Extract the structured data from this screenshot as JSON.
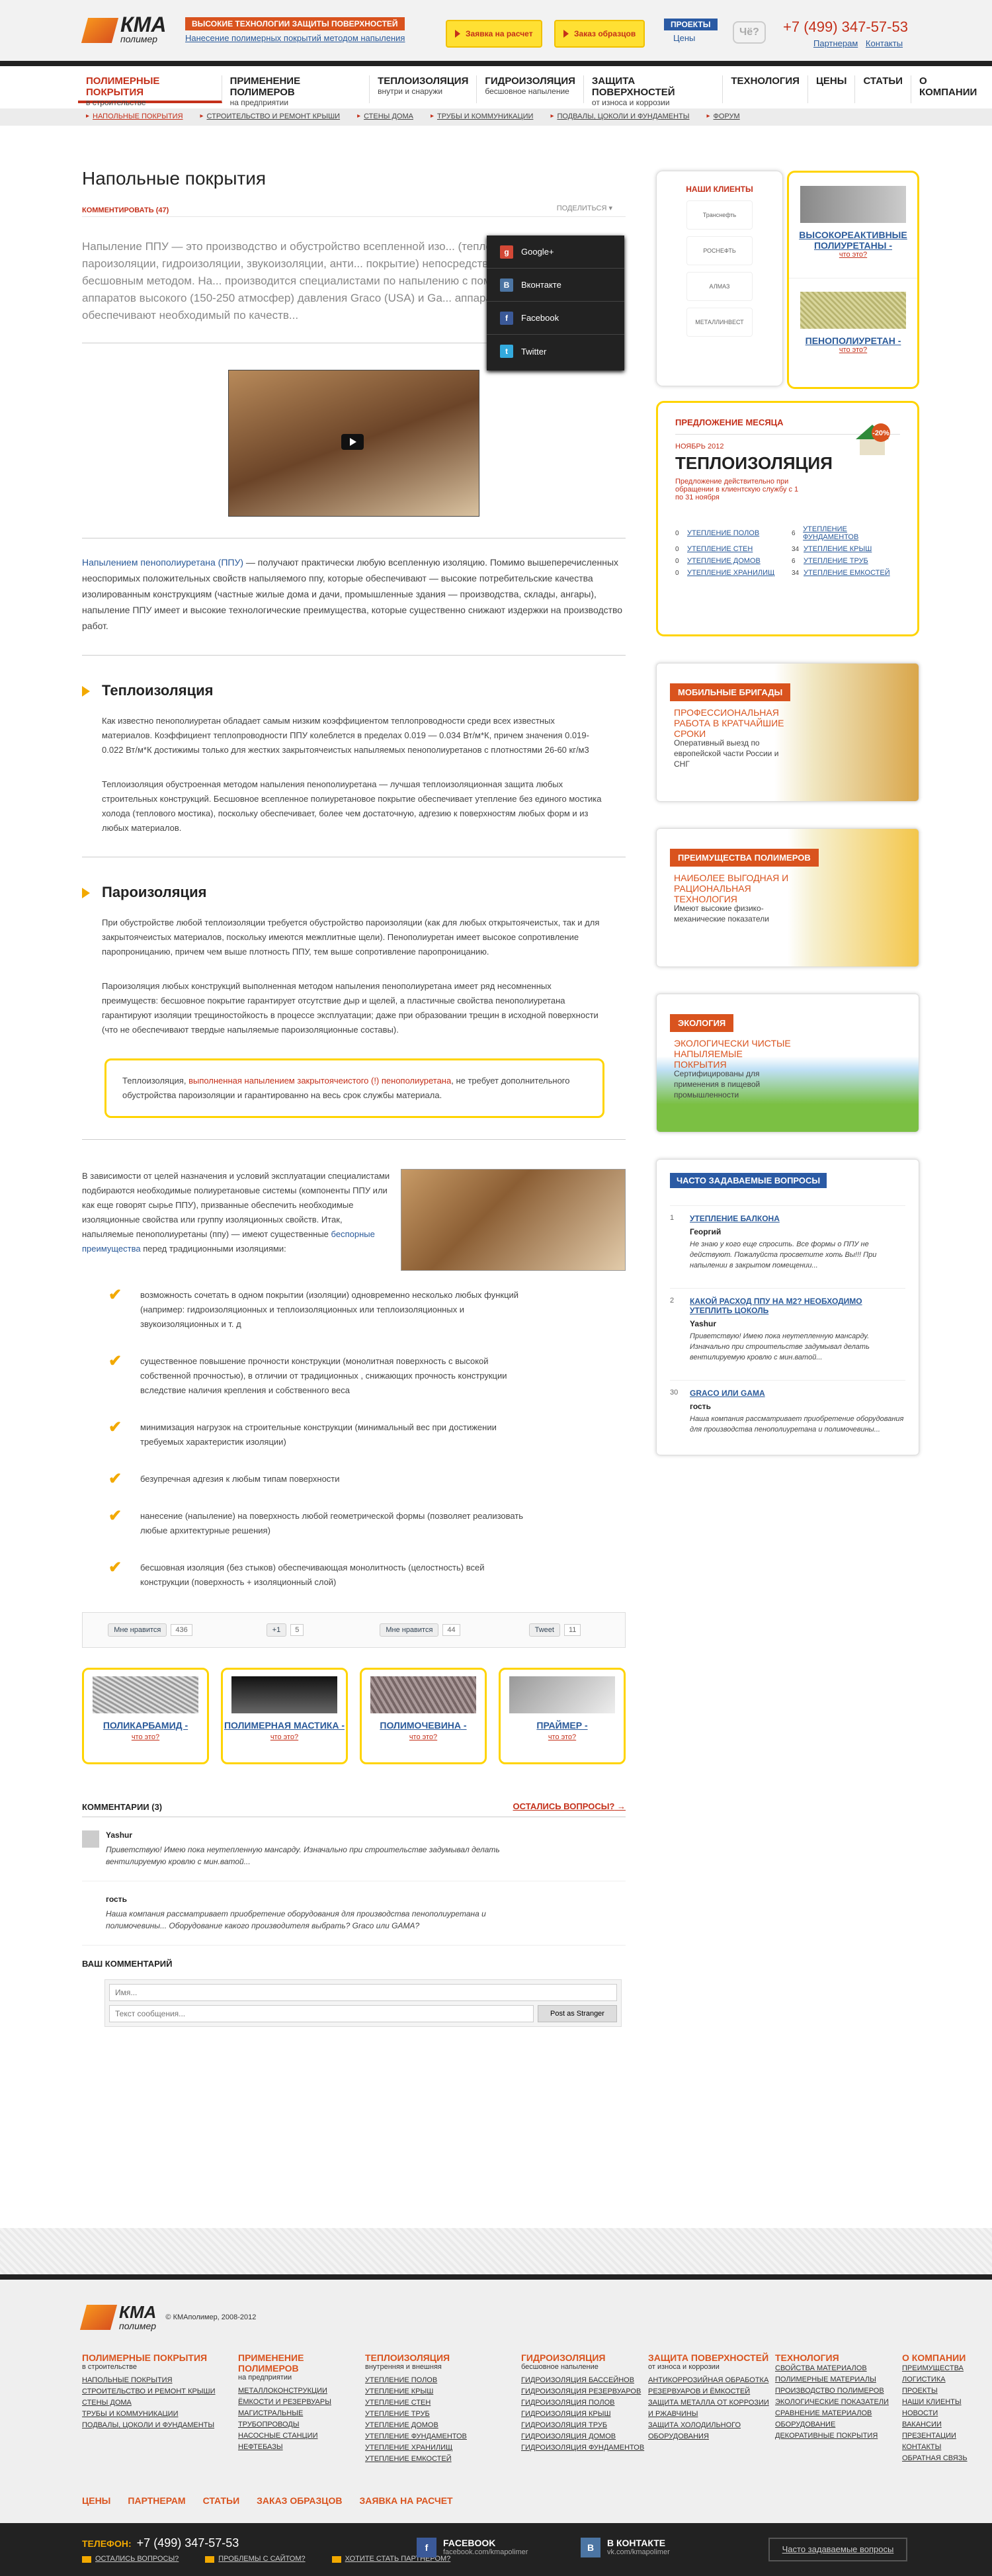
{
  "header": {
    "logo_main": "КМА",
    "logo_sub": "полимер",
    "slogan_tag": "ВЫСОКИЕ ТЕХНОЛОГИИ ЗАЩИТЫ ПОВЕРХНОСТЕЙ",
    "slogan_sub": "Нанесение полимерных покрытий методом напыления",
    "btn_request": "Заявка на расчет",
    "btn_samples": "Заказ образцов",
    "projects_tag": "ПРОЕКТЫ",
    "projects_sub": "Цены",
    "chevo": "Чё?",
    "phone": "+7 (499) 347-57-53",
    "partners": "Партнерам",
    "contacts": "Контакты"
  },
  "nav": [
    {
      "label": "ПОЛИМЕРНЫЕ ПОКРЫТИЯ",
      "sub": "в строительстве"
    },
    {
      "label": "ПРИМЕНЕНИЕ ПОЛИМЕРОВ",
      "sub": "на предприятии"
    },
    {
      "label": "ТЕПЛОИЗОЛЯЦИЯ",
      "sub": "внутри и снаружи"
    },
    {
      "label": "ГИДРОИЗОЛЯЦИЯ",
      "sub": "бесшовное напыление"
    },
    {
      "label": "ЗАЩИТА ПОВЕРХНОСТЕЙ",
      "sub": "от износа и коррозии"
    },
    {
      "label": "ТЕХНОЛОГИЯ",
      "sub": ""
    },
    {
      "label": "ЦЕНЫ",
      "sub": ""
    },
    {
      "label": "СТАТЬИ",
      "sub": ""
    },
    {
      "label": "О КОМПАНИИ",
      "sub": ""
    }
  ],
  "subnav": [
    "НАПОЛЬНЫЕ ПОКРЫТИЯ",
    "СТРОИТЕЛЬСТВО И РЕМОНТ КРЫШИ",
    "СТЕНЫ ДОМА",
    "ТРУБЫ И КОММУНИКАЦИИ",
    "ПОДВАЛЫ, ЦОКОЛИ И ФУНДАМЕНТЫ",
    "ФОРУМ"
  ],
  "main": {
    "title": "Напольные покрытия",
    "comment_link": "КОММЕНТИРОВАТЬ (47)",
    "share_link": "ПОДЕЛИТЬСЯ",
    "lead": "Напыление ППУ — это производство и обустройство всепленной изо... (теплоизоляции, пароизоляции, гидроизоляции, звукоизоляции, анти... покрытие) непосредственно на поверхности бесшовным методом. На... производится специалистами по напылению с помощью специально... аппаратов высокого (150-250 атмосфер) давления Graco (USA) и Ga... аппараты высокого давления обеспечивают необходимый по качеств...",
    "share_menu": [
      "Google+",
      "Вконтакте",
      "Facebook",
      "Twitter"
    ],
    "para1_link": "Напылением пенополиуретана (ППУ)",
    "para1": " — получают практически любую всепленную изоляцию. Помимо вышеперечисленных неоспоримых положительных свойств напыляемого ппу, которые обеспечивают — высокие потребительские качества изолированным конструкциям (частные жилые дома и дачи, промышленные здания — производства, склады, ангары), напыление ППУ имеет и высокие технологические преимущества, которые существенно снижают издержки на производство работ.",
    "h_teplo": "Теплоизоляция",
    "teplo1": "Как известно пенополиуретан обладает самым низким коэффициентом теплопроводности среди всех известных материалов. Коэффициент теплопроводности ППУ колеблется в пределах 0.019 — 0.034 Вт/м*К, причем значения 0.019-0.022 Вт/м*К достижимы только для жестких закрытоячеистых напыляемых пенополиуретанов с плотностями 26-60 кг/м3",
    "teplo2": "Теплоизоляция обустроенная методом напыления пенополиуретана — лучшая теплоизоляционная защита любых строительных конструкций. Бесшовное всепленное полиуретановое покрытие обеспечивает утепление без единого мостика холода (теплового мостика), поскольку обеспечивает, более чем достаточную, адгезию к поверхностям любых форм и из любых материалов.",
    "h_paro": "Пароизоляция",
    "paro1": "При обустройстве любой теплоизоляции требуется обустройство пароизоляции (как для любых открытоячеистых, так и для закрытоячеистых материалов, поскольку имеются межплитные щели). Пенополиуретан имеет высокое сопротивление паропроницанию, причем чем выше плотность ППУ, тем выше сопротивление паропроницанию.",
    "paro2": "Пароизоляция любых конструкций выполненная методом напыления пенополиуретана имеет ряд несомненных преимуществ: бесшовное покрытие гарантирует отсутствие дыр и щелей, а пластичные свойства пенополиуретана гарантируют изоляции трещиностойкость в процессе эксплуатации; даже при образовании трещин в исходной поверхности (что не обеспечивают твердые напыляемые пароизоляционные составы).",
    "callout_pre": "Теплоизоляция, ",
    "callout_red": "выполненная напылением закрытоячеистого (!) пенополиуретана",
    "callout_post": ", не требует дополнительного обустройства пароизоляции и гарантированно на весь срок службы материала.",
    "two_text": "В зависимости от целей назначения и условий эксплуатации специалистами подбираются необходимые полиуретановые системы (компоненты ППУ или как еще говорят сырье ППУ), призванные обеспечить необходимые изоляционные свойства или группу изоляционных свойств. Итак, напыляемые пенополиуретаны (ппу) — имеют существенные",
    "two_link": "беспорные преимущества",
    "two_tail": " перед традиционными изоляциями:",
    "checks": [
      "возможность сочетать в одном покрытии (изоляции) одновременно несколько любых функций (например: гидроизоляционных и теплоизоляционных или теплоизоляционных и звукоизоляционных и т. д",
      "существенное повышение прочности конструкции (монолитная поверхность с высокой собственной прочностью), в отличии от традиционных , снижающих прочность конструкции вследствие наличия крепления и собственного веса",
      "минимизация нагрузок на строительные конструкции (минимальный вес при достижении требуемых характеристик изоляции)",
      "безупречная адгезия к любым типам поверхности",
      "нанесение (напыление) на поверхность любой геометрической формы (позволяет реализовать любые архитектурные решения)",
      "бесшовная изоляция (без стыков) обеспечивающая монолитность (целостность) всей конструкции (поверхность + изоляционный слой)"
    ],
    "social": [
      {
        "label": "Мне нравится",
        "count": "436"
      },
      {
        "label": "+1",
        "count": "5"
      },
      {
        "label": "Мне нравится",
        "count": "44"
      },
      {
        "label": "Tweet",
        "count": "11"
      }
    ],
    "products": [
      {
        "name": "ПОЛИКАРБАМИД -",
        "what": "что это?"
      },
      {
        "name": "ПОЛИМЕРНАЯ МАСТИКА -",
        "what": "что это?"
      },
      {
        "name": "ПОЛИМОЧЕВИНА -",
        "what": "что это?"
      },
      {
        "name": "ПРАЙМЕР -",
        "what": "что это?"
      }
    ],
    "comments_title": "КОММЕНТАРИИ (3)",
    "comments_ask": "ОСТАЛИСЬ ВОПРОСЫ?",
    "comments": [
      {
        "author": "Yashur",
        "text": "Приветствую! Имею пока неутепленную мансарду. Изначально при строительстве задумывал делать вентилируемую кровлю с мин.ватой..."
      },
      {
        "author": "гость",
        "text": "Наша компания рассматривает приобретение оборудования для производства пенополиуретана и полимочевины... Оборудование какого производителя выбрать? Graco или GAMA?"
      }
    ],
    "your_comment": "ВАШ КОММЕНТАРИЙ",
    "name_placeholder": "Имя...",
    "msg_placeholder": "Текст сообщения...",
    "post_btn": "Post as Stranger"
  },
  "sidebar": {
    "clients_title": "НАШИ КЛИЕНТЫ",
    "clients": [
      "Транснефть",
      "РОСНЕФТЬ",
      "АЛМАЗ",
      "МЕТАЛЛИНВЕСТ"
    ],
    "minis": [
      {
        "name": "ВЫСОКОРЕАКТИВНЫЕ ПОЛИУРЕТАНЫ -",
        "what": "что это?"
      },
      {
        "name": "ПЕНОПОЛИУРЕТАН -",
        "what": "что это?"
      }
    ],
    "offer_title": "ПРЕДЛОЖЕНИЕ МЕСЯЦА",
    "offer_month": "НОЯБРЬ 2012",
    "offer_name": "ТЕПЛОИЗОЛЯЦИЯ",
    "offer_desc": "Предложение действительно при обращении в клиентскую службу с 1 по 31 ноября",
    "offer_badge": "-20%",
    "offer_items": [
      {
        "n": "0",
        "label": "УТЕПЛЕНИЕ ПОЛОВ"
      },
      {
        "n": "6",
        "label": "УТЕПЛЕНИЕ ФУНДАМЕНТОВ"
      },
      {
        "n": "0",
        "label": "УТЕПЛЕНИЕ СТЕН"
      },
      {
        "n": "34",
        "label": "УТЕПЛЕНИЕ КРЫШ"
      },
      {
        "n": "0",
        "label": "УТЕПЛЕНИЕ ДОМОВ"
      },
      {
        "n": "6",
        "label": "УТЕПЛЕНИЕ ТРУБ"
      },
      {
        "n": "0",
        "label": "УТЕПЛЕНИЕ ХРАНИЛИЩ"
      },
      {
        "n": "34",
        "label": "УТЕПЛЕНИЕ ЕМКОСТЕЙ"
      }
    ],
    "promos": [
      {
        "tag": "МОБИЛЬНЫЕ БРИГАДЫ",
        "sub": "ПРОФЕССИОНАЛЬНАЯ РАБОТА В КРАТЧАЙШИЕ СРОКИ",
        "desc": "Оперативный выезд по европейской части России и СНГ"
      },
      {
        "tag": "ПРЕИМУЩЕСТВА ПОЛИМЕРОВ",
        "sub": "НАИБОЛЕЕ ВЫГОДНАЯ И РАЦИОНАЛЬНАЯ ТЕХНОЛОГИЯ",
        "desc": "Имеют высокие физико-механические показатели"
      },
      {
        "tag": "ЭКОЛОГИЯ",
        "sub": "ЭКОЛОГИЧЕСКИ ЧИСТЫЕ НАПЫЛЯЕМЫЕ ПОКРЫТИЯ",
        "desc": "Сертифицированы для применения в пищевой промышленности"
      }
    ],
    "faq_title": "ЧАСТО ЗАДАВАЕМЫЕ ВОПРОСЫ",
    "faq": [
      {
        "n": "1",
        "q": "УТЕПЛЕНИЕ БАЛКОНА",
        "author": "Георгий",
        "text": "Не знаю у кого еще спросить. Все формы о ППУ не действуют. Пожалуйста просветите хоть Вы!!! При напылении в закрытом помещении..."
      },
      {
        "n": "2",
        "q": "КАКОЙ РАСХОД ППУ НА М2? НЕОБХОДИМО УТЕПЛИТЬ ЦОКОЛЬ",
        "author": "Yashur",
        "text": "Приветствую! Имею пока неутепленную мансарду. Изначально при строительстве задумывал делать вентилируемую кровлю с мин.ватой..."
      },
      {
        "n": "30",
        "q": "GRACO ИЛИ GAMA",
        "author": "гость",
        "text": "Наша компания рассматривает приобретение оборудования для производства пенополиуретана и полимочевины..."
      }
    ]
  },
  "footer": {
    "copy": "© КМАполимер, 2008-2012",
    "cols": [
      {
        "h": "ПОЛИМЕРНЫЕ ПОКРЫТИЯ",
        "s": "в строительстве",
        "links": [
          "НАПОЛЬНЫЕ ПОКРЫТИЯ",
          "СТРОИТЕЛЬСТВО И РЕМОНТ КРЫШИ",
          "СТЕНЫ ДОМА",
          "ТРУБЫ И КОММУНИКАЦИИ",
          "ПОДВАЛЫ, ЦОКОЛИ И ФУНДАМЕНТЫ"
        ]
      },
      {
        "h": "ПРИМЕНЕНИЕ ПОЛИМЕРОВ",
        "s": "на предприятии",
        "links": [
          "МЕТАЛЛОКОНСТРУКЦИИ",
          "ЁМКОСТИ И РЕЗЕРВУАРЫ",
          "МАГИСТРАЛЬНЫЕ ТРУБОПРОВОДЫ",
          "НАСОСНЫЕ СТАНЦИИ",
          "НЕФТЕБАЗЫ"
        ]
      },
      {
        "h": "ТЕПЛОИЗОЛЯЦИЯ",
        "s": "внутренняя и внешняя",
        "links": [
          "УТЕПЛЕНИЕ ПОЛОВ",
          "УТЕПЛЕНИЕ КРЫШ",
          "УТЕПЛЕНИЕ СТЕН",
          "УТЕПЛЕНИЕ ТРУБ",
          "УТЕПЛЕНИЕ ДОМОВ",
          "УТЕПЛЕНИЕ ФУНДАМЕНТОВ",
          "УТЕПЛЕНИЕ ХРАНИЛИЩ",
          "УТЕПЛЕНИЕ ЕМКОСТЕЙ"
        ]
      },
      {
        "h": "ГИДРОИЗОЛЯЦИЯ",
        "s": "бесшовное напыление",
        "links": [
          "ГИДРОИЗОЛЯЦИЯ БАССЕЙНОВ",
          "ГИДРОИЗОЛЯЦИЯ РЕЗЕРВУАРОВ",
          "ГИДРОИЗОЛЯЦИЯ ПОЛОВ",
          "ГИДРОИЗОЛЯЦИЯ КРЫШ",
          "ГИДРОИЗОЛЯЦИЯ ТРУБ",
          "ГИДРОИЗОЛЯЦИЯ ДОМОВ",
          "ГИДРОИЗОЛЯЦИЯ ФУНДАМЕНТОВ"
        ]
      },
      {
        "h": "ЗАЩИТА ПОВЕРХНОСТЕЙ",
        "s": "от износа и коррозии",
        "links": [
          "АНТИКОРРОЗИЙНАЯ ОБРАБОТКА РЕЗЕРВУАРОВ И ЁМКОСТЕЙ",
          "ЗАЩИТА МЕТАЛЛА ОТ КОРРОЗИИ И РЖАВЧИНЫ",
          "ЗАЩИТА ХОЛОДИЛЬНОГО ОБОРУДОВАНИЯ"
        ]
      },
      {
        "h": "ТЕХНОЛОГИЯ",
        "s": "",
        "links": [
          "СВОЙСТВА МАТЕРИАЛОВ",
          "ПОЛИМЕРНЫЕ МАТЕРИАЛЫ",
          "ПРОИЗВОДСТВО ПОЛИМЕРОВ",
          "ЭКОЛОГИЧЕСКИЕ ПОКАЗАТЕЛИ",
          "СРАВНЕНИЕ МАТЕРИАЛОВ",
          "ОБОРУДОВАНИЕ",
          "ДЕКОРАТИВНЫЕ ПОКРЫТИЯ"
        ]
      },
      {
        "h": "О КОМПАНИИ",
        "s": "",
        "links": [
          "ПРЕИМУЩЕСТВА",
          "ЛОГИСТИКА",
          "ПРОЕКТЫ",
          "НАШИ КЛИЕНТЫ",
          "НОВОСТИ",
          "ВАКАНСИИ",
          "ПРЕЗЕНТАЦИИ",
          "КОНТАКТЫ",
          "ОБРАТНАЯ СВЯЗЬ"
        ]
      }
    ],
    "links": [
      "ЦЕНЫ",
      "ПАРТНЕРАМ",
      "СТАТЬИ",
      "ЗАКАЗ ОБРАЗЦОВ",
      "ЗАЯВКА НА РАСЧЕТ"
    ],
    "phone_label": "ТЕЛЕФОН:",
    "phone": "+7 (499) 347-57-53",
    "bar_links": [
      "ОСТАЛИСЬ ВОПРОСЫ?",
      "ПРОБЛЕМЫ С САЙТОМ?",
      "ХОТИТЕ СТАТЬ ПАРТНЕРОМ?"
    ],
    "fb_title": "FACEBOOK",
    "fb_url": "facebook.com/kmapolimer",
    "vk_title": "В КОНТАКТЕ",
    "vk_url": "vk.com/kmapolimer",
    "faq_link": "Часто задаваемые вопросы"
  }
}
